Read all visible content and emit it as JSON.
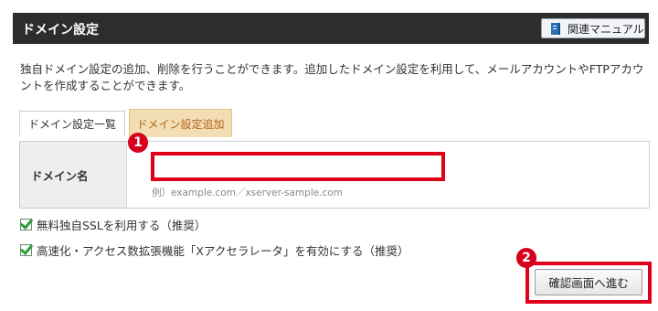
{
  "header": {
    "title": "ドメイン設定",
    "manual_label": "関連マニュアル"
  },
  "description": "独自ドメイン設定の追加、削除を行うことができます。追加したドメイン設定を利用して、メールアカウントやFTPアカウントを作成することができます。",
  "tabs": [
    {
      "label": "ドメイン設定一覧",
      "active": false
    },
    {
      "label": "ドメイン設定追加",
      "active": true
    }
  ],
  "form": {
    "domain_label": "ドメイン名",
    "domain_value": "",
    "example": "例）example.com／xserver-sample.com"
  },
  "options": [
    {
      "label": "無料独自SSLを利用する（推奨）",
      "checked": true
    },
    {
      "label": "高速化・アクセス数拡張機能「Xアクセラレータ」を有効にする（推奨）",
      "checked": true
    }
  ],
  "confirm_label": "確認画面へ進む",
  "markers": [
    "1",
    "2"
  ],
  "colors": {
    "header_bg": "#2d2d2d",
    "active_tab_bg": "#f3ddb4",
    "active_tab_text": "#b5651a",
    "highlight": "#e0001a",
    "check": "#2e9c3a"
  }
}
